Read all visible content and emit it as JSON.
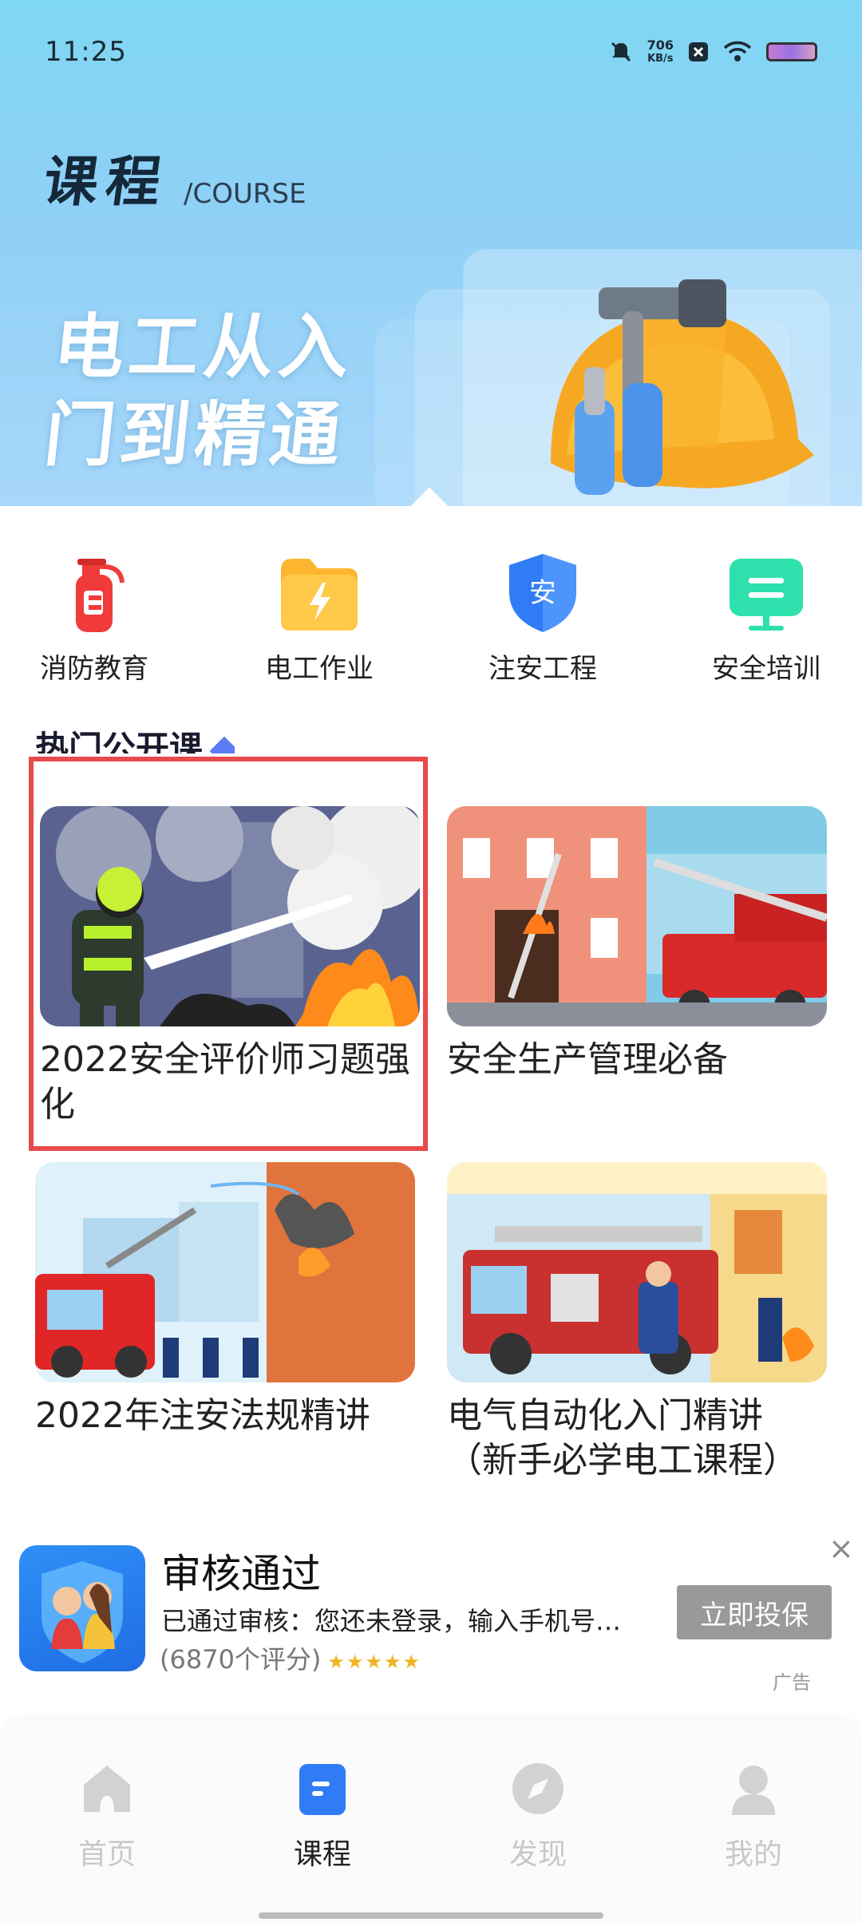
{
  "status_bar": {
    "time": "11:25",
    "speed_value": "706",
    "speed_unit": "KB/s"
  },
  "header": {
    "title_cn": "课程",
    "title_en": "/COURSE",
    "banner_line1": "电工从入",
    "banner_line2": "门到精通"
  },
  "categories": [
    {
      "label": "消防教育",
      "icon": "fire-extinguisher-icon"
    },
    {
      "label": "电工作业",
      "icon": "lightning-folder-icon"
    },
    {
      "label": "注安工程",
      "icon": "safety-shield-icon",
      "badge": "安"
    },
    {
      "label": "安全培训",
      "icon": "training-board-icon"
    }
  ],
  "section": {
    "title": "热门公开课"
  },
  "courses": [
    {
      "title": "2022安全评价师习题强化"
    },
    {
      "title": "安全生产管理必备"
    },
    {
      "title": "2022年注安法规精讲"
    },
    {
      "title": "电气自动化入门精讲（新手必学电工课程）"
    }
  ],
  "ad": {
    "title": "审核通过",
    "description": "已通过审核：您还未登录，输入手机号…",
    "rating": "(6870个评分)",
    "stars": "★★★★★",
    "button": "立即投保",
    "close": "×",
    "tag": "广告"
  },
  "nav": [
    {
      "label": "首页",
      "icon": "home-icon"
    },
    {
      "label": "课程",
      "icon": "course-icon"
    },
    {
      "label": "发现",
      "icon": "discover-compass-icon"
    },
    {
      "label": "我的",
      "icon": "profile-icon"
    }
  ],
  "colors": {
    "accent": "#2f7cf6",
    "highlight_border": "#e84a4a",
    "header_top": "#7fd7f3"
  }
}
